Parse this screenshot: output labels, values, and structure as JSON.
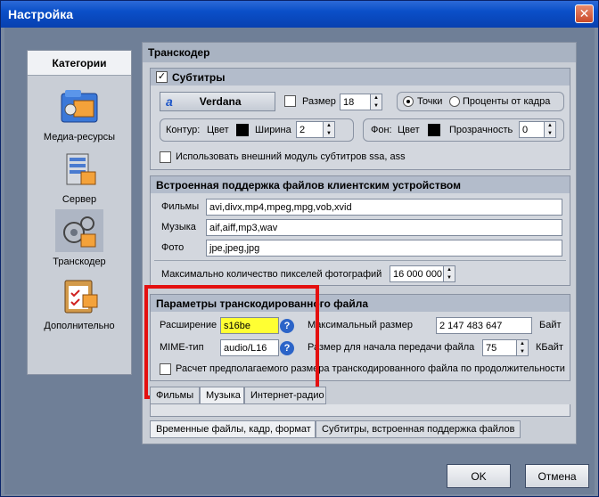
{
  "window": {
    "title": "Настройка",
    "close_glyph": "✕"
  },
  "sidebar": {
    "header": "Категории",
    "items": [
      {
        "label": "Медиа-ресурсы",
        "icon": "media-folder-icon"
      },
      {
        "label": "Сервер",
        "icon": "server-icon"
      },
      {
        "label": "Транскодер",
        "icon": "transcoder-gear-icon",
        "selected": true
      },
      {
        "label": "Дополнительно",
        "icon": "clipboard-icon"
      }
    ]
  },
  "main": {
    "title": "Транскодер",
    "subtitles": {
      "title": "Субтитры",
      "font_name": "Verdana",
      "font_glyph": "a",
      "size_label": "Размер",
      "size_value": "18",
      "units_points": "Точки",
      "units_percent": "Проценты от кадра",
      "outline_label": "Контур:",
      "outline_color_label": "Цвет",
      "outline_width_label": "Ширина",
      "outline_width_value": "2",
      "bg_label": "Фон:",
      "bg_color_label": "Цвет",
      "bg_transparency_label": "Прозрачность",
      "bg_transparency_value": "0",
      "external_module_label": "Использовать внешний модуль субтитров ssa, ass"
    },
    "client_support": {
      "title": "Встроенная поддержка файлов клиентским устройством",
      "films_label": "Фильмы",
      "films_value": "avi,divx,mp4,mpeg,mpg,vob,xvid",
      "music_label": "Музыка",
      "music_value": "aif,aiff,mp3,wav",
      "photo_label": "Фото",
      "photo_value": "jpe,jpeg,jpg",
      "max_pixels_label": "Максимально количество пикселей фотографий",
      "max_pixels_value": "16 000 000"
    },
    "transcode_params": {
      "title": "Параметры транскодированного файла",
      "extension_label": "Расширение",
      "extension_value": "s16be",
      "mime_label": "MIME-тип",
      "mime_value": "audio/L16",
      "max_size_label": "Максимальный размер",
      "max_size_value": "2 147 483 647",
      "max_size_unit": "Байт",
      "start_size_label": "Размер для начала передачи файла",
      "start_size_value": "75",
      "start_size_unit": "КБайт",
      "estimate_label": "Расчет предполагаемого размера транскодированного файла по продолжительности"
    },
    "tabs_row1": [
      "Фильмы",
      "Музыка",
      "Интернет-радио"
    ],
    "tabs_row2": [
      "Временные файлы, кадр, формат",
      "Субтитры, встроенная поддержка файлов"
    ]
  },
  "buttons": {
    "ok": "OK",
    "cancel": "Отмена"
  },
  "colors": {
    "highlight_field": "#ffff33",
    "annotation_red": "#e41010",
    "title_blue": "#0a4fc8"
  }
}
